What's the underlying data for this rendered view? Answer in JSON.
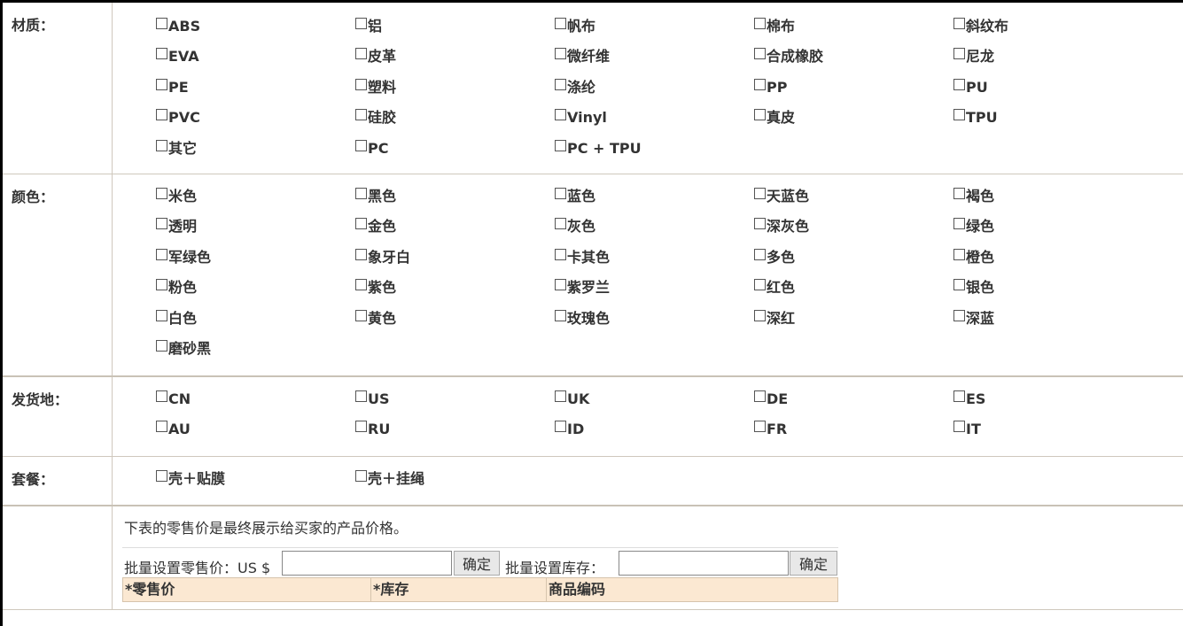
{
  "sections": {
    "material": {
      "label": "材质：",
      "options": [
        "ABS",
        "铝",
        "帆布",
        "棉布",
        "斜纹布",
        "EVA",
        "皮革",
        "微纤维",
        "合成橡胶",
        "尼龙",
        "PE",
        "塑料",
        "涤纶",
        "PP",
        "PU",
        "PVC",
        "硅胶",
        "Vinyl",
        "真皮",
        "TPU",
        "其它",
        "PC",
        "PC + TPU"
      ]
    },
    "color": {
      "label": "颜色：",
      "options": [
        "米色",
        "黑色",
        "蓝色",
        "天蓝色",
        "褐色",
        "透明",
        "金色",
        "灰色",
        "深灰色",
        "绿色",
        "军绿色",
        "象牙白",
        "卡其色",
        "多色",
        "橙色",
        "粉色",
        "紫色",
        "紫罗兰",
        "红色",
        "银色",
        "白色",
        "黄色",
        "玫瑰色",
        "深红",
        "深蓝",
        "磨砂黑"
      ]
    },
    "ship_from": {
      "label": "发货地：",
      "options": [
        "CN",
        "US",
        "UK",
        "DE",
        "ES",
        "AU",
        "RU",
        "ID",
        "FR",
        "IT"
      ]
    },
    "bundle": {
      "label": "套餐：",
      "options": [
        "壳＋贴膜",
        "壳＋挂绳"
      ]
    }
  },
  "pricing": {
    "note": "下表的零售价是最终展示给买家的产品价格。",
    "batch_price_label": "批量设置零售价：US $",
    "batch_price_value": "",
    "confirm_label": "确定",
    "batch_stock_label": "批量设置库存：",
    "batch_stock_value": "",
    "columns": [
      "*零售价",
      "*库存",
      "商品编码"
    ]
  },
  "colors": {
    "header_bg": "#fbe8d2",
    "border": "#cfc8bd"
  }
}
